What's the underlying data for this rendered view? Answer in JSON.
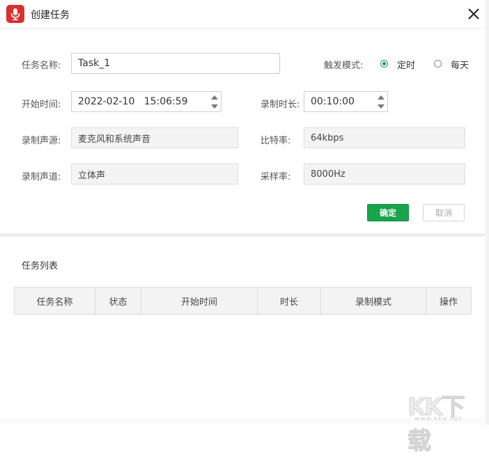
{
  "window": {
    "title": "创建任务",
    "app_icon": "microphone-icon",
    "close_icon": "close-icon"
  },
  "form": {
    "task_name": {
      "label": "任务名称:",
      "value": "Task_1"
    },
    "trigger_mode": {
      "label": "触发模式:",
      "options": [
        "定时",
        "每天"
      ],
      "selected": "定时"
    },
    "start_time": {
      "label": "开始时间:",
      "value": "2022-02-10   15:06:59"
    },
    "duration": {
      "label": "录制时长:",
      "value": "00:10:00"
    },
    "audio_source": {
      "label": "录制声源:",
      "value": "麦克风和系统声音"
    },
    "bitrate": {
      "label": "比特率:",
      "value": "64kbps"
    },
    "channel": {
      "label": "录制声道:",
      "value": "立体声"
    },
    "sample_rate": {
      "label": "采样率:",
      "value": "8000Hz"
    }
  },
  "buttons": {
    "confirm": "确定",
    "cancel": "取消"
  },
  "task_list": {
    "title": "任务列表",
    "columns": [
      "任务名称",
      "状态",
      "开始时间",
      "时长",
      "录制模式",
      "操作"
    ],
    "rows": []
  },
  "watermark": {
    "text": "KK下载",
    "url": "www.kkx.net"
  },
  "colors": {
    "accent": "#17a44b",
    "app_icon": "#d9312b"
  }
}
